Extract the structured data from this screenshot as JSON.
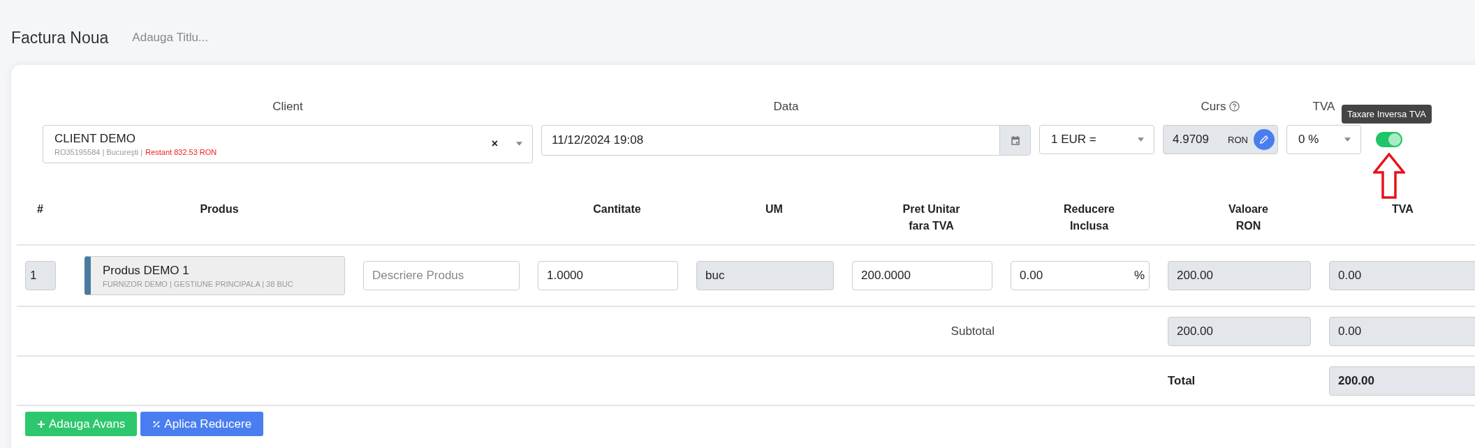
{
  "page": {
    "title": "Factura Noua",
    "title_placeholder": "Adauga Titlu..."
  },
  "client": {
    "label": "Client",
    "name": "CLIENT DEMO",
    "details": "RO35195584 | Bucureşti |",
    "balance": "Restant 832.53 RON",
    "clear": "×"
  },
  "date": {
    "label": "Data",
    "value": "11/12/2024 19:08"
  },
  "currency": {
    "value": "1 EUR ="
  },
  "rate": {
    "label": "Curs",
    "value": "4.9709",
    "unit": "RON"
  },
  "vat": {
    "label": "TVA",
    "value": "0 %"
  },
  "reverse_charge": {
    "on": true,
    "tooltip": "Taxare Inversa TVA"
  },
  "table": {
    "columns": [
      "#",
      "Produs",
      "Cantitate",
      "UM",
      "Pret Unitar\nfara TVA",
      "Reducere\nInclusa",
      "Valoare\nRON",
      "TVA"
    ],
    "rows": [
      {
        "index": "1",
        "product": "Produs DEMO 1",
        "product_details": "FURNIZOR DEMO | GESTIUNE PRINCIPALA | 38 BUC",
        "description_placeholder": "Descriere Produs",
        "quantity": "1.0000",
        "unit": "buc",
        "price": "200.0000",
        "discount": "0.00",
        "discount_unit": "%",
        "value": "200.00",
        "vat": "0.00"
      }
    ],
    "subtotal": {
      "label": "Subtotal",
      "value": "200.00",
      "vat": "0.00"
    },
    "total": {
      "label": "Total",
      "value": "200.00"
    }
  },
  "buttons": [
    {
      "label": "Adauga Avans",
      "kind": "add"
    },
    {
      "label": "Aplica Reducere",
      "kind": "discount"
    }
  ]
}
